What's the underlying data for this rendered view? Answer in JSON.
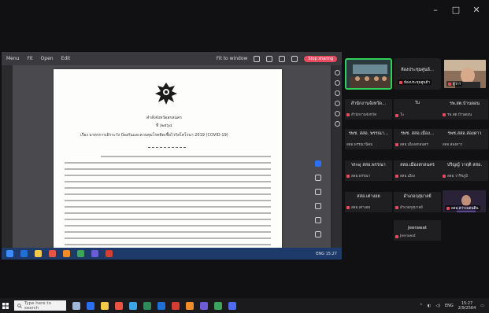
{
  "window": {
    "minimize": "–",
    "maximize": "□",
    "close": "✕"
  },
  "pdf_toolbar": {
    "menu": [
      "Menu",
      "Fit",
      "Open",
      "Edit"
    ],
    "zoom_label": "Fit to window",
    "share_button": "Stop sharing"
  },
  "document": {
    "header_line_1": "คำสั่งจังหวัดสกลนคร",
    "header_line_2": "ที่  /๒๕๖๔",
    "subject": "เรื่อง มาตรการเฝ้าระวัง ป้องกันและควบคุมโรคติดเชื้อไวรัสโคโรนา 2019 (COVID-19)"
  },
  "inner_taskbar": {
    "tray_text": "ENG 15:27"
  },
  "participants": [
    {
      "name": "ห้องประชุมศูนย์...",
      "sub": "ห้องประชุมศูนย์ฯ",
      "muted": true
    },
    {
      "name": "ผู้ว่าราชการจังหวัด",
      "sub": "ผู้ว่าฯ",
      "muted": true
    },
    {
      "name": "สำนักงานจังหวัด...",
      "sub": "สำนักงานจังหวัด",
      "muted": true
    },
    {
      "name": "Tu",
      "sub": "Tu",
      "muted": true
    },
    {
      "name": "รพ.สต.บ้านดอน",
      "sub": "รพ.สต.บ้านดอน",
      "muted": true
    },
    {
      "name": "รพช. สสอ. พรรณา...",
      "sub": "สสอ.พรรณานิคม",
      "muted": false
    },
    {
      "name": "รพช. สสอ.เมือง...",
      "sub": "สสอ.เมืองสกลนคร",
      "muted": false
    },
    {
      "name": "รพช.สสอ.ส่องดาว",
      "sub": "สสอ.ส่องดาว",
      "muted": false
    },
    {
      "name": "Viraj สสอ.พรรณา",
      "sub": "สสอ.พรรณา",
      "muted": true
    },
    {
      "name": "สสอ.เมืองสกลนคร",
      "sub": "สสอ.เมือง",
      "muted": true
    },
    {
      "name": "ปริญญ์ วาฤติ สสอ.",
      "sub": "สสอ.วาริชภูมิ",
      "muted": true
    },
    {
      "name": "สสอ.เต่างอย",
      "sub": "สสอ.เต่างอย",
      "muted": true
    },
    {
      "name": "อำเภอกุสุมาลย์",
      "sub": "อำเภอกุสุมาลย์",
      "muted": true
    },
    {
      "name": "",
      "sub": "สสอ.สว่างแดนดิน",
      "muted": true
    },
    {
      "name": "Jeerawat",
      "sub": "Jeerawat",
      "muted": true
    }
  ],
  "taskbar": {
    "search_placeholder": "Type here to search",
    "time": "15:27",
    "date": "2/9/2564",
    "lang": "ENG"
  },
  "colors": {
    "accent_blue": "#2b6ff2",
    "mic_off_red": "#e84a5f",
    "active_speaker_green": "#30d05c"
  }
}
